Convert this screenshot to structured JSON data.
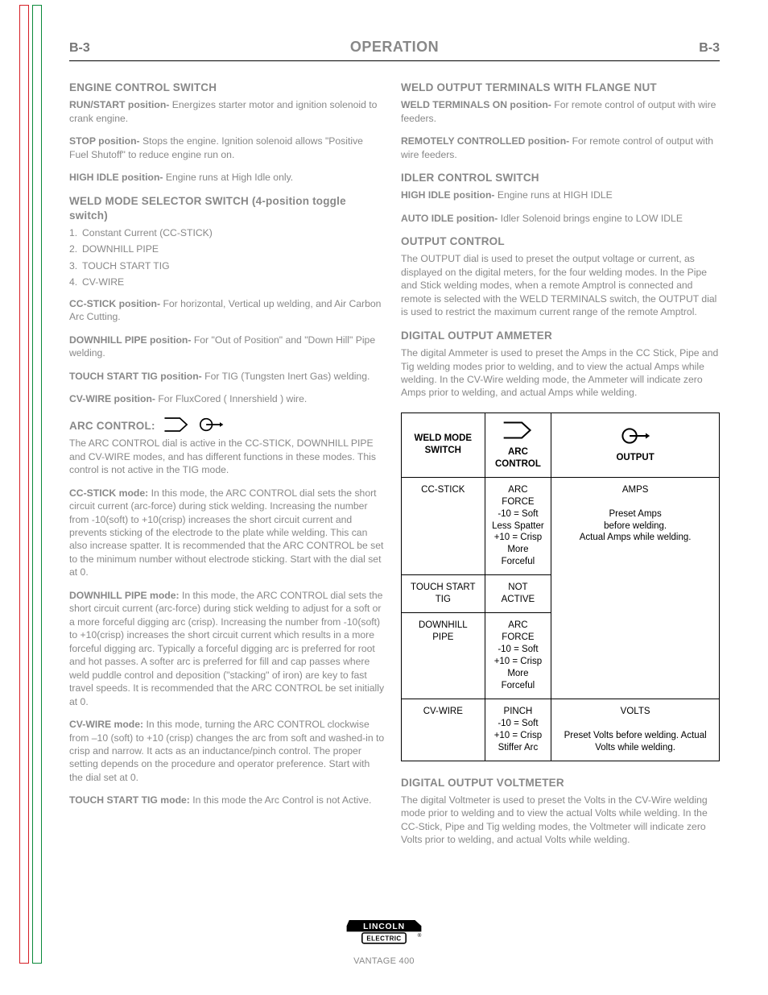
{
  "header": {
    "page_id_left": "B-3",
    "section_title": "OPERATION",
    "page_id_right": "B-3"
  },
  "left": {
    "engine_switch": {
      "heading": "ENGINE CONTROL SWITCH",
      "run_start_label": "RUN/START position-",
      "run_start_text": "Energizes starter motor and ignition solenoid to crank engine.",
      "stop_label": "STOP position-",
      "stop_text": "Stops the engine. Ignition solenoid allows \"Positive Fuel Shutoff\" to reduce engine run on.",
      "high_idle_label": "HIGH IDLE position-",
      "high_idle_text": "Engine runs at High Idle only."
    },
    "weld_mode": {
      "heading": "WELD MODE SELECTOR SWITCH (4-position toggle switch)",
      "items": [
        {
          "n": "1.",
          "t": "Constant Current (CC-STICK)"
        },
        {
          "n": "2.",
          "t": "DOWNHILL PIPE"
        },
        {
          "n": "3.",
          "t": "TOUCH START TIG"
        },
        {
          "n": "4.",
          "t": "CV-WIRE"
        }
      ],
      "cc_label": "CC-STICK position-",
      "cc_text": "For horizontal, Vertical up welding, and Air Carbon Arc Cutting.",
      "dp_label": "DOWNHILL PIPE position-",
      "dp_text": "For \"Out of Position\" and \"Down Hill\" Pipe welding.",
      "tp_label": "TOUCH START TIG position-",
      "tp_text": "For TIG (Tungsten Inert Gas) welding.",
      "cv_label": "CV-WIRE position-",
      "cv_text": "For FluxCored ( Innershield ) wire."
    },
    "arc_control": {
      "heading": "ARC CONTROL:",
      "intro": "The ARC CONTROL dial is active in the CC-STICK, DOWNHILL PIPE and CV-WIRE modes, and has different functions in these modes. This control is not active in the TIG mode.",
      "ccstick_label": "CC-STICK mode:",
      "ccstick_text": "In this mode, the ARC CONTROL dial sets the short circuit current (arc-force) during stick welding. Increasing the number from -10(soft) to +10(crisp) increases the short circuit current and prevents sticking of the electrode to the plate while welding. This can also increase spatter. It is recommended that the ARC CONTROL be set to the minimum number without electrode sticking. Start with the dial set at 0.",
      "dp_label": "DOWNHILL PIPE mode:",
      "dp_text": "In this mode, the ARC CONTROL dial sets the short circuit current (arc-force) during stick welding to adjust for a soft or a more forceful digging arc (crisp). Increasing the number from -10(soft) to +10(crisp) increases the short circuit current which results in a more forceful digging arc. Typically a forceful digging arc is preferred for root and hot passes. A softer arc is preferred for fill and cap passes where weld puddle control and deposition (\"stacking\" of iron) are key to fast travel speeds. It is recommended that the ARC CONTROL be set initially at 0.",
      "wire_label": "CV-WIRE mode:",
      "wire_text": "In this mode, turning the ARC CONTROL clockwise from –10 (soft) to +10 (crisp) changes the arc from soft and washed-in to crisp and narrow. It acts as an inductance/pinch control. The proper setting depends on the procedure and operator preference. Start with the dial set at 0.",
      "tp_label": "TOUCH START TIG mode:",
      "tp_text": "In this mode the Arc Control is not Active."
    }
  },
  "right": {
    "weld_terminals": {
      "heading": "WELD OUTPUT TERMINALS WITH FLANGE NUT",
      "on_label": "WELD TERMINALS ON position-",
      "on_text": "For remote control of output with wire feeders.",
      "remote_label": "REMOTELY CONTROLLED position-",
      "remote_text": "For remote control of output with wire feeders."
    },
    "idler": {
      "heading": "IDLER CONTROL SWITCH",
      "high_label": "HIGH IDLE position-",
      "high_text": "Engine runs at HIGH IDLE",
      "auto_label": "AUTO IDLE position-",
      "auto_text": "Idler Solenoid brings engine to LOW IDLE"
    },
    "output": {
      "heading": "OUTPUT CONTROL",
      "text": "The OUTPUT dial is used to preset the output voltage or current, as displayed on the digital meters, for the four welding modes. In the Pipe and Stick welding modes, when a remote Amptrol is connected and remote is selected with the WELD TERMINALS switch, the OUTPUT dial is used to restrict the maximum current range of the remote Amptrol."
    },
    "ammeter": {
      "heading": "DIGITAL OUTPUT AMMETER",
      "text": "The digital Ammeter is used to preset the Amps in the CC Stick, Pipe and Tig welding modes prior to welding, and to view the actual Amps while welding. In the CV-Wire welding mode, the Ammeter will indicate zero Amps prior to welding, and actual Amps while welding."
    },
    "table": {
      "head": {
        "mode_line1": "WELD MODE",
        "mode_line2": "SWITCH",
        "arc_line1": "ARC",
        "arc_line2": "CONTROL",
        "output": "OUTPUT"
      },
      "rows": [
        {
          "mode": "CC-STICK",
          "arc_l1": "ARC FORCE",
          "arc_l2": "-10 = Soft",
          "arc_l3": "Less Spatter",
          "arc_l4": "+10 = Crisp",
          "arc_l5": "More Forceful",
          "out_l1": "AMPS",
          "out_l2": "Preset Amps",
          "out_l3": "before welding.",
          "out_l4": "Actual Amps while welding."
        },
        {
          "mode": "TOUCH START TIG",
          "arc": "NOT ACTIVE"
        },
        {
          "mode_l1": "DOWNHILL",
          "mode_l2": "PIPE",
          "arc_l1": "ARC FORCE",
          "arc_l2": "-10 = Soft",
          "arc_l3": "+10 = Crisp",
          "arc_l4": "More Forceful"
        },
        {
          "mode": "CV-WIRE",
          "arc_l1": "PINCH",
          "arc_l2": "-10 = Soft",
          "arc_l3": "+10 = Crisp",
          "arc_l4": "Stiffer Arc",
          "out_l1": "VOLTS",
          "out_l2": "Preset Volts before welding. Actual Volts while welding."
        }
      ]
    },
    "voltmeter": {
      "heading": "DIGITAL OUTPUT VOLTMETER",
      "text": "The digital Voltmeter is used to preset the Volts in the CV-Wire welding mode prior to welding and to view the actual Volts while welding. In the CC-Stick, Pipe and Tig welding modes, the Voltmeter will indicate zero Volts prior to welding, and actual Volts while welding."
    }
  },
  "footer": {
    "model": "VANTAGE 400"
  }
}
